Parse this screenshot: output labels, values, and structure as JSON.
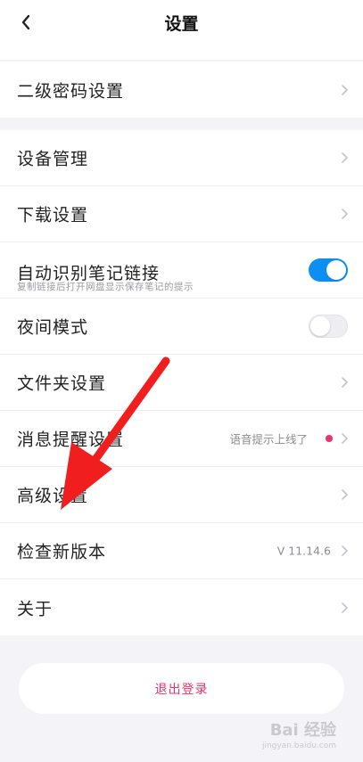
{
  "header": {
    "title": "设置",
    "back_icon": "chevron-left-icon"
  },
  "group1": {
    "items": [
      {
        "label": "二级密码设置"
      }
    ]
  },
  "group2": {
    "items": [
      {
        "label": "设备管理"
      },
      {
        "label": "下载设置"
      },
      {
        "label": "自动识别笔记链接",
        "subtitle": "复制链接后打开网盘显示保存笔记的提示",
        "toggle": true
      },
      {
        "label": "夜间模式",
        "toggle": false
      },
      {
        "label": "文件夹设置"
      },
      {
        "label": "消息提醒设置",
        "value": "语音提示上线了",
        "badge_color": "#f0306a"
      },
      {
        "label": "高级设置"
      },
      {
        "label": "检查新版本",
        "value": "V 11.14.6"
      },
      {
        "label": "关于"
      }
    ]
  },
  "logout": {
    "label": "退出登录"
  },
  "colors": {
    "accent": "#0c8ff2",
    "danger": "#f0306a",
    "annotation_arrow": "#f01e1e"
  },
  "watermark": {
    "text": "Bai 经验",
    "sub": "jingyan.baidu.com"
  }
}
